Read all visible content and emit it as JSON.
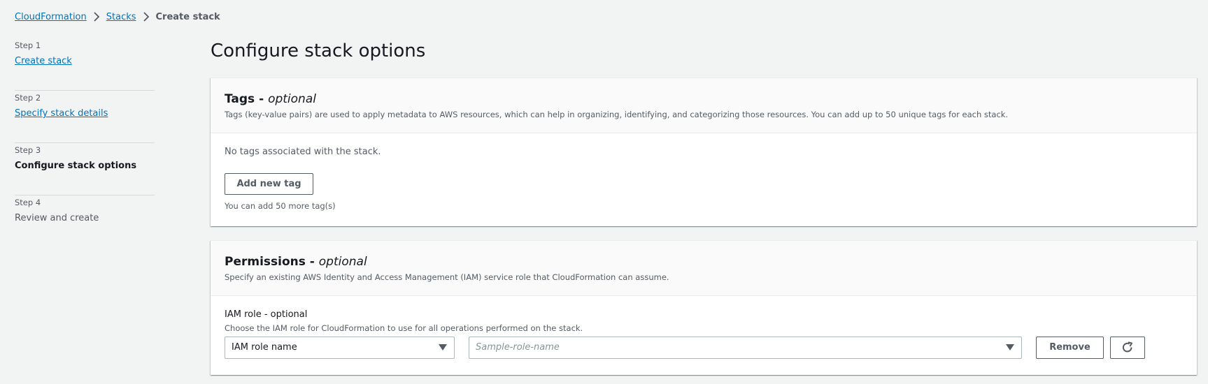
{
  "breadcrumb": {
    "items": [
      "CloudFormation",
      "Stacks"
    ],
    "current": "Create stack"
  },
  "steps": [
    {
      "number": "Step 1",
      "title": "Create stack"
    },
    {
      "number": "Step 2",
      "title": "Specify stack details"
    },
    {
      "number": "Step 3",
      "title": "Configure stack options"
    },
    {
      "number": "Step 4",
      "title": "Review and create"
    }
  ],
  "page": {
    "title": "Configure stack options"
  },
  "tags": {
    "heading": "Tags - ",
    "heading_suffix": "optional",
    "description": "Tags (key-value pairs) are used to apply metadata to AWS resources, which can help in organizing, identifying, and categorizing those resources. You can add up to 50 unique tags for each stack.",
    "empty_text": "No tags associated with the stack.",
    "add_button": "Add new tag",
    "hint": "You can add 50 more tag(s)"
  },
  "permissions": {
    "heading": "Permissions - ",
    "heading_suffix": "optional",
    "description": "Specify an existing AWS Identity and Access Management (IAM) service role that CloudFormation can assume.",
    "field_label": "IAM role - optional",
    "field_description": "Choose the IAM role for CloudFormation to use for all operations performed on the stack.",
    "type_select_value": "IAM role name",
    "role_placeholder": "Sample-role-name",
    "remove_button": "Remove"
  },
  "icons": {
    "breadcrumb_separator": "chevron-right-icon",
    "select_caret": "caret-down-icon",
    "refresh": "refresh-icon"
  },
  "colors": {
    "link": "#0073bb",
    "background": "#f2f3f3",
    "text": "#16191f",
    "secondary_text": "#545b64"
  }
}
